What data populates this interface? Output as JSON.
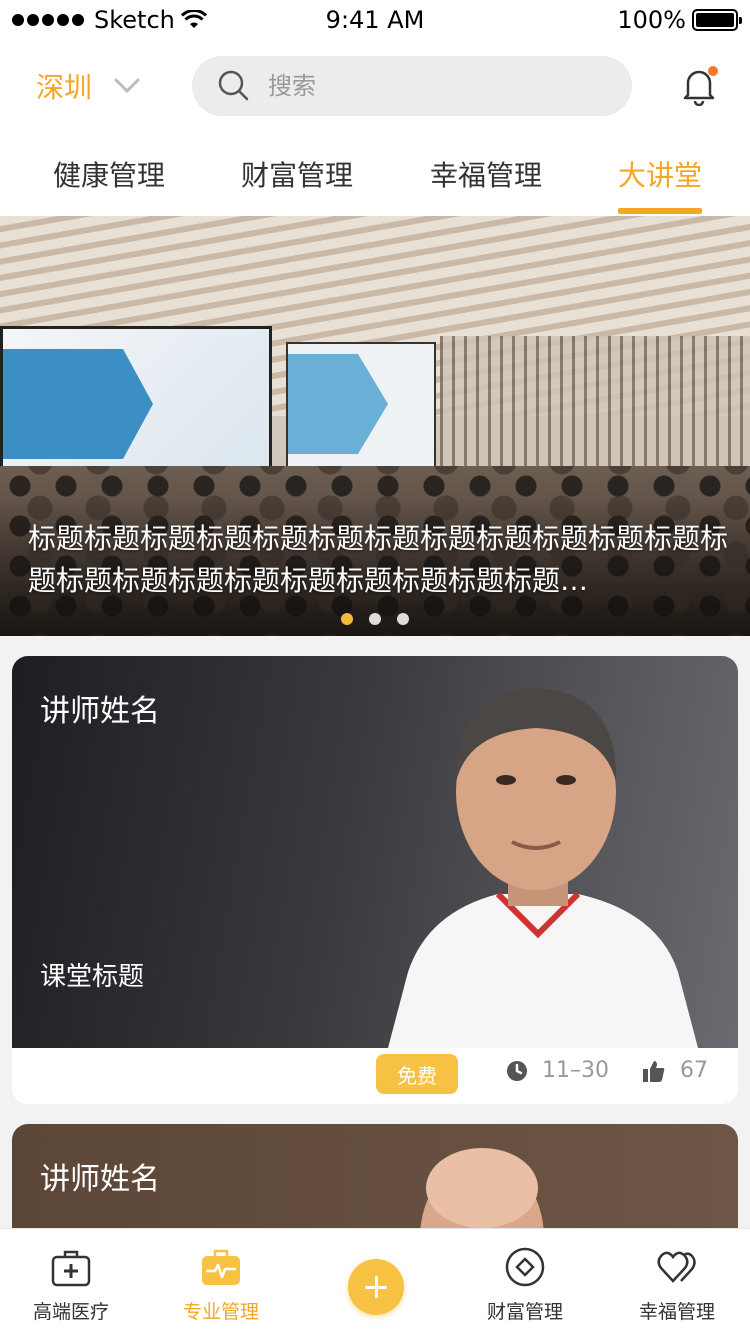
{
  "status_bar": {
    "carrier": "Sketch",
    "time": "9:41 AM",
    "battery": "100%"
  },
  "header": {
    "city": "深圳",
    "search_placeholder": "搜索",
    "tabs": [
      {
        "label": "健康管理",
        "active": false
      },
      {
        "label": "财富管理",
        "active": false
      },
      {
        "label": "幸福管理",
        "active": false
      },
      {
        "label": "大讲堂",
        "active": true
      }
    ]
  },
  "banner": {
    "title": "标题标题标题标题标题标题标题标题标题标题标题标题标题标题标题标题标题标题标题标题标题标题…",
    "page_count": 3,
    "active_page": 0
  },
  "lectures": [
    {
      "lecturer": "讲师姓名",
      "course_title": "课堂标题",
      "price_tag": "免费",
      "date": "11–30",
      "likes": "67"
    },
    {
      "lecturer": "讲师姓名"
    }
  ],
  "tab_bar": {
    "items": [
      {
        "label": "高端医疗",
        "icon": "medical-kit-icon",
        "active": false
      },
      {
        "label": "专业管理",
        "icon": "briefcase-pulse-icon",
        "active": true
      },
      {
        "label": "财富管理",
        "icon": "diamond-icon",
        "active": false
      },
      {
        "label": "幸福管理",
        "icon": "hearts-icon",
        "active": false
      }
    ]
  },
  "colors": {
    "accent": "#f5a623",
    "badge": "#f7c244",
    "notification_dot": "#f7762c"
  }
}
